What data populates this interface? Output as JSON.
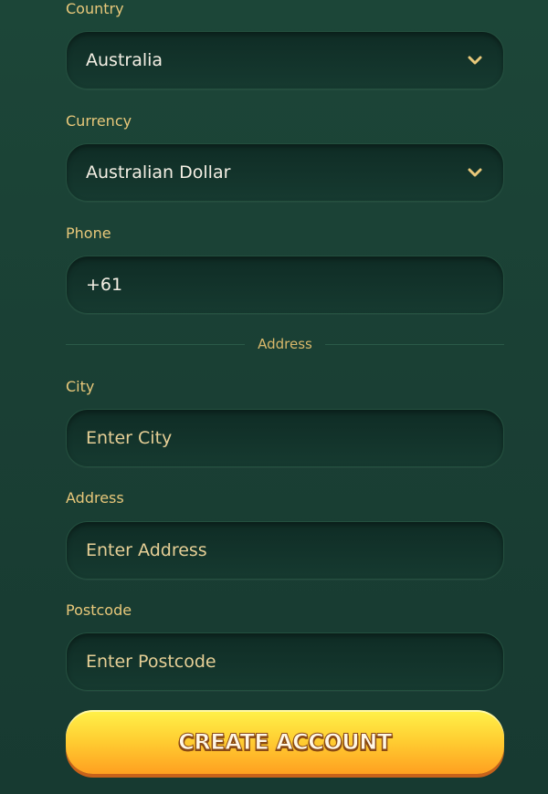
{
  "form": {
    "country": {
      "label": "Country",
      "value": "Australia",
      "icon": "chevron-down-icon"
    },
    "currency": {
      "label": "Currency",
      "value": "Australian Dollar",
      "icon": "chevron-down-icon"
    },
    "phone": {
      "label": "Phone",
      "value": "+61"
    },
    "address_section": {
      "title": "Address"
    },
    "city": {
      "label": "City",
      "placeholder": "Enter City"
    },
    "address": {
      "label": "Address",
      "placeholder": "Enter Address"
    },
    "postcode": {
      "label": "Postcode",
      "placeholder": "Enter Postcode"
    },
    "submit_label": "CREATE ACCOUNT"
  },
  "colors": {
    "background": "#1a3f34",
    "label": "#e8c87a",
    "button_top": "#fff24a",
    "button_bottom": "#ffa020"
  }
}
